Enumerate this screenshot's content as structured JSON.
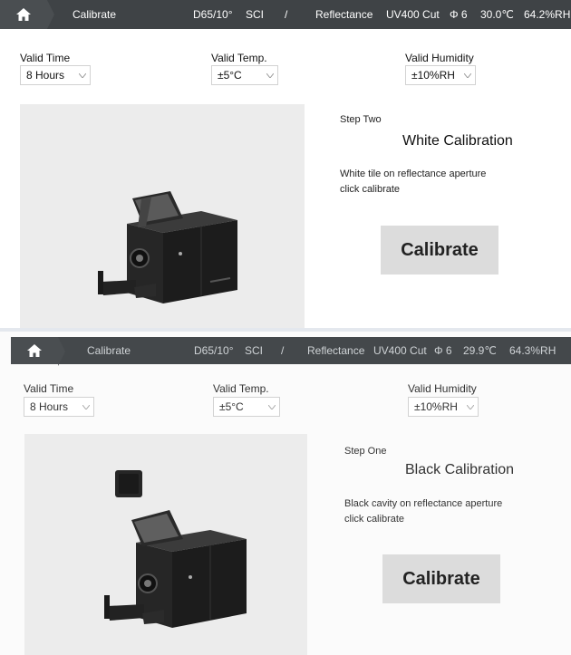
{
  "screens": [
    {
      "topbar": {
        "title": "Calibrate",
        "illuminant": "D65/10°",
        "mode": "SCI",
        "separator": "/",
        "measure_type": "Reflectance",
        "uv_filter": "UV400 Cut",
        "aperture": "Φ 6",
        "temperature": "30.0℃",
        "humidity": "64.2%RH"
      },
      "valid_time": {
        "label": "Valid Time",
        "value": "8 Hours"
      },
      "valid_temp": {
        "label": "Valid Temp.",
        "value": "±5°C"
      },
      "valid_humidity": {
        "label": "Valid Humidity",
        "value": "±10%RH"
      },
      "step": {
        "label": "Step Two",
        "title": "White Calibration",
        "instruction_1": "White tile on reflectance aperture",
        "instruction_2": "click calibrate"
      },
      "calibrate_label": "Calibrate"
    },
    {
      "topbar": {
        "title": "Calibrate",
        "illuminant": "D65/10°",
        "mode": "SCI",
        "separator": "/",
        "measure_type": "Reflectance",
        "uv_filter": "UV400 Cut",
        "aperture": "Φ 6",
        "temperature": "29.9℃",
        "humidity": "64.3%RH"
      },
      "valid_time": {
        "label": "Valid Time",
        "value": "8 Hours"
      },
      "valid_temp": {
        "label": "Valid Temp.",
        "value": "±5°C"
      },
      "valid_humidity": {
        "label": "Valid Humidity",
        "value": "±10%RH"
      },
      "step": {
        "label": "Step One",
        "title": "Black Calibration",
        "instruction_1": "Black cavity on reflectance aperture",
        "instruction_2": "click calibrate"
      },
      "calibrate_label": "Calibrate"
    }
  ],
  "colors": {
    "topbar": "#3f4346",
    "button": "#dcdcdc",
    "image_bg": "#ececec"
  },
  "icons": [
    "home-icon",
    "chevron-down-icon",
    "instrument-image",
    "black-cavity-image"
  ]
}
